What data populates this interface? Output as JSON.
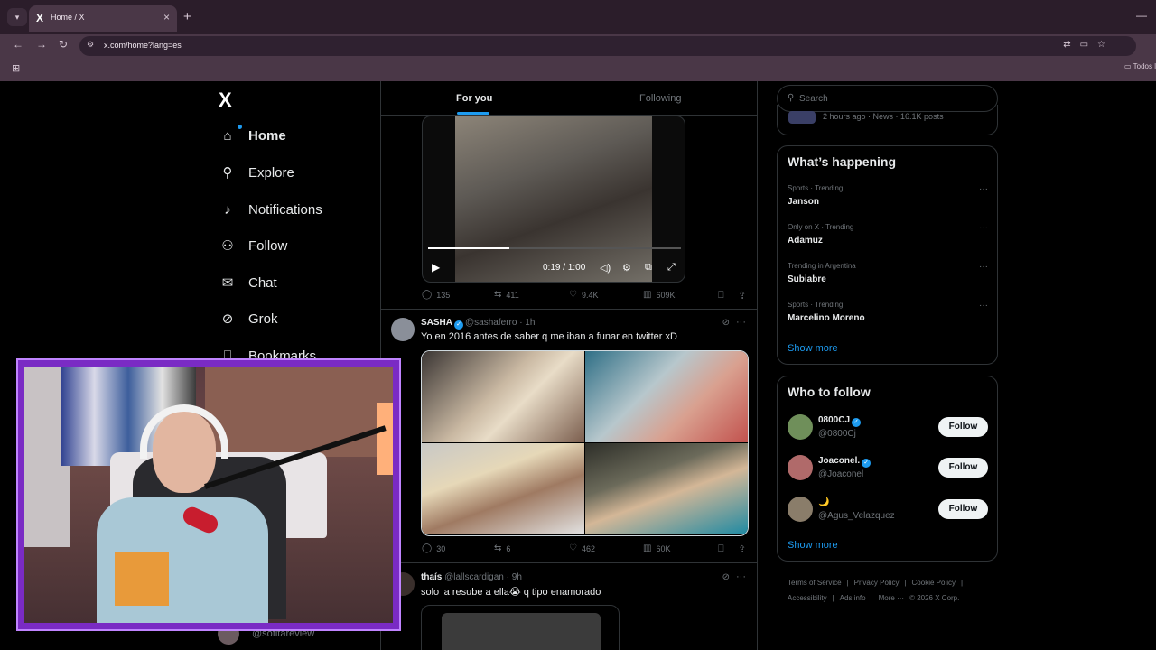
{
  "browser": {
    "tab_title": "Home / X",
    "tab_favicon": "X",
    "url": "x.com/home?lang=es",
    "bookmark_label": "Todos l"
  },
  "nav": {
    "logo": "X",
    "items": [
      {
        "label": "Home",
        "icon": "home-icon",
        "glyph": "⌂"
      },
      {
        "label": "Explore",
        "icon": "search-icon",
        "glyph": "⚲"
      },
      {
        "label": "Notifications",
        "icon": "bell-icon",
        "glyph": "♪"
      },
      {
        "label": "Follow",
        "icon": "person-add-icon",
        "glyph": "⚇"
      },
      {
        "label": "Chat",
        "icon": "mail-icon",
        "glyph": "✉"
      },
      {
        "label": "Grok",
        "icon": "grok-icon",
        "glyph": "⊘"
      },
      {
        "label": "Bookmarks",
        "icon": "bookmark-icon",
        "glyph": "⎕"
      }
    ],
    "user_handle": "@sofitareview"
  },
  "feed": {
    "tabs": {
      "for_you": "For you",
      "following": "Following"
    },
    "video_post": {
      "time_display": "0:19 / 1:00",
      "progress": 0.32,
      "stats": {
        "replies": "135",
        "reposts": "411",
        "likes": "9.4K",
        "views": "609K"
      }
    },
    "post1": {
      "name": "SASHA",
      "handle": "@sashaferro",
      "time": "· 1h",
      "text": "Yo en 2016 antes de saber q me iban a funar en twitter xD",
      "stats": {
        "replies": "30",
        "reposts": "6",
        "likes": "462",
        "views": "60K"
      }
    },
    "post2": {
      "name": "thaís",
      "handle": "@lallscardigan",
      "time": "· 9h",
      "text": "solo la resube a ella😭 q tipo enamorado"
    }
  },
  "right": {
    "search_placeholder": "Search",
    "news_meta": "2 hours ago · News · 16.1K posts",
    "happening_title": "What’s happening",
    "trends": [
      {
        "context": "Sports · Trending",
        "name": "Janson"
      },
      {
        "context": "Only on X · Trending",
        "name": "Adamuz"
      },
      {
        "context": "Trending in Argentina",
        "name": "Subiabre"
      },
      {
        "context": "Sports · Trending",
        "name": "Marcelino Moreno"
      }
    ],
    "show_more": "Show more",
    "who_title": "Who to follow",
    "follow_suggestions": [
      {
        "name": "0800CJ",
        "handle": "@0800Cj",
        "verified": true,
        "button": "Follow"
      },
      {
        "name": "Joaconel.",
        "handle": "@Joaconel",
        "verified": true,
        "button": "Follow"
      },
      {
        "name": "🌙",
        "handle": "@Agus_Velazquez",
        "verified": false,
        "button": "Follow"
      }
    ],
    "footer": [
      "Terms of Service",
      "|",
      "Privacy Policy",
      "|",
      "Cookie Policy",
      "|",
      "Accessibility",
      "|",
      "Ads info",
      "|",
      "More ···",
      "© 2026 X Corp."
    ]
  },
  "colors": {
    "accent": "#1d9bf0",
    "background": "#000000",
    "chrome": "#4a3747",
    "webcam_border": "#7a2bc4"
  }
}
